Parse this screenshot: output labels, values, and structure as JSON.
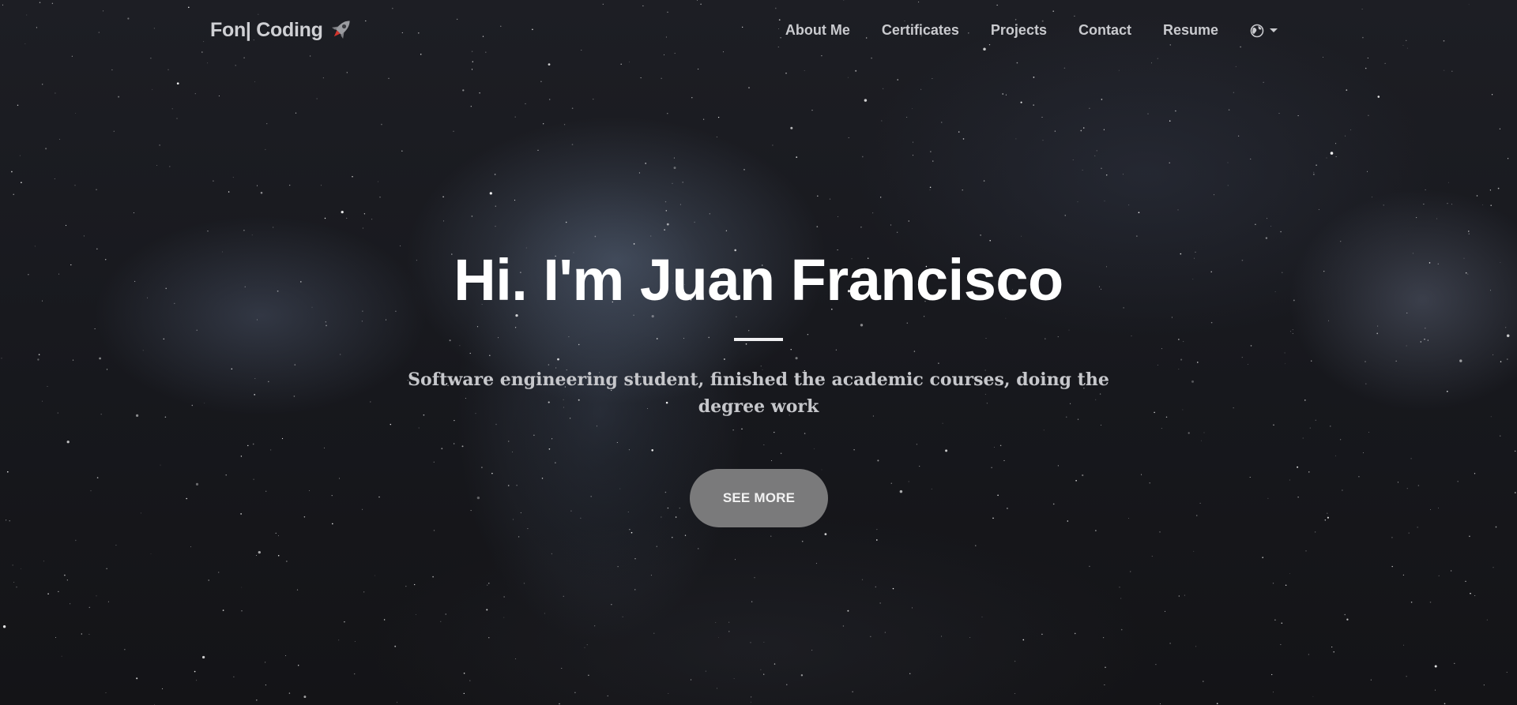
{
  "brand": {
    "text": "Fon| Coding",
    "icon": "rocket-icon"
  },
  "nav": {
    "items": [
      {
        "label": "About Me"
      },
      {
        "label": "Certificates"
      },
      {
        "label": "Projects"
      },
      {
        "label": "Contact"
      },
      {
        "label": "Resume"
      }
    ],
    "language_icon": "globe-icon",
    "language_caret_icon": "caret-down-icon"
  },
  "hero": {
    "title": "Hi. I'm Juan Francisco",
    "subtitle": "Software engineering student, finished the academic courses, doing the degree work",
    "button_label": "SEE MORE"
  },
  "colors": {
    "background": "#151518",
    "nav_text": "#c9cace",
    "title_text": "#ffffff",
    "subtitle_text": "#c6c7cb",
    "button_bg": "#7a7a7b",
    "button_text": "#f2f2f2"
  }
}
